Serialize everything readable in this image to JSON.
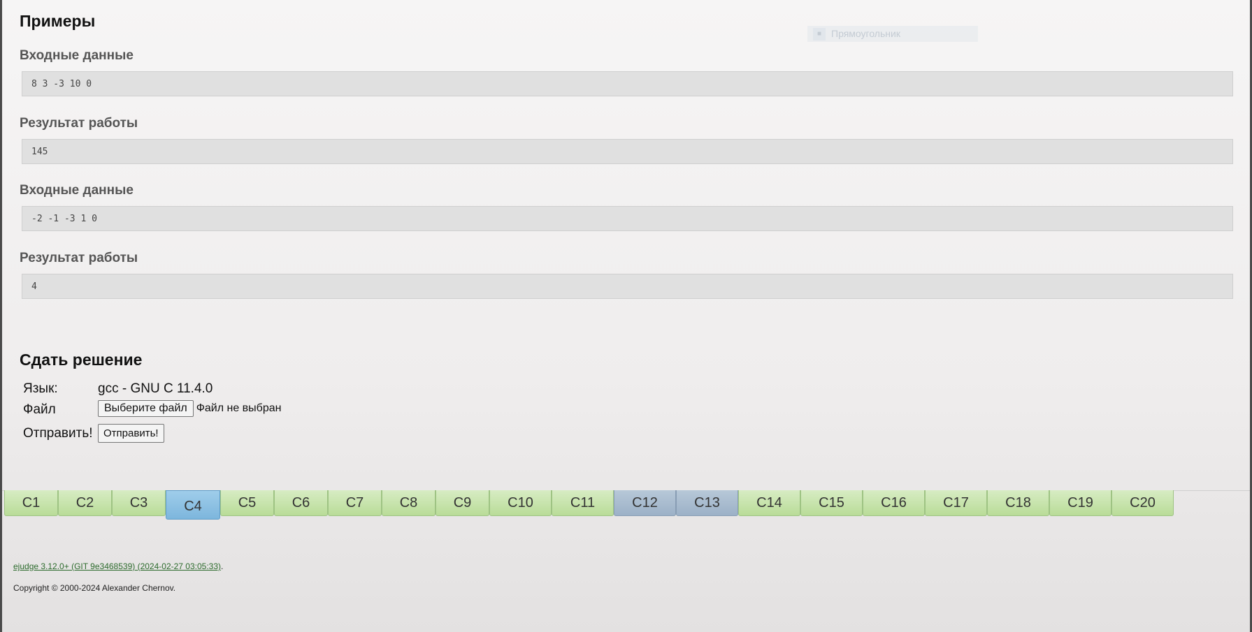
{
  "overlay": {
    "ghost_label": "Прямоугольник"
  },
  "examples": {
    "title": "Примеры",
    "items": [
      {
        "heading": "Входные данные",
        "value": "8 3 -3 10 0"
      },
      {
        "heading": "Результат работы",
        "value": "145"
      },
      {
        "heading": "Входные данные",
        "value": "-2 -1 -3 1 0"
      },
      {
        "heading": "Результат работы",
        "value": "4"
      }
    ]
  },
  "submit": {
    "title": "Сдать решение",
    "language_label": "Язык:",
    "language_value": "gcc - GNU C 11.4.0",
    "file_label": "Файл",
    "file_button": "Выберите файл",
    "file_status": "Файл не выбран",
    "send_label": "Отправить!",
    "send_button": "Отправить!"
  },
  "tabs": {
    "current": "C4",
    "items": [
      "C1",
      "C2",
      "C3",
      "C4",
      "C5",
      "C6",
      "C7",
      "C8",
      "C9",
      "C10",
      "C11",
      "C12",
      "C13",
      "C14",
      "C15",
      "C16",
      "C17",
      "C18",
      "C19",
      "C20"
    ],
    "states": [
      "ok",
      "ok",
      "ok",
      "current",
      "ok",
      "ok",
      "ok",
      "ok",
      "ok",
      "ok",
      "ok",
      "other",
      "other",
      "ok",
      "ok",
      "ok",
      "ok",
      "ok",
      "ok",
      "ok"
    ]
  },
  "footer": {
    "version_link": "ejudge 3.12.0+ (GIT 9e3468539) (2024-02-27 03:05:33)",
    "version_suffix": ".",
    "copyright": "Copyright © 2000-2024 Alexander Chernov."
  },
  "colors": {
    "tab_ok": "#c6e4ab",
    "tab_current": "#8cc2e4",
    "tab_other": "#a9bdd0",
    "link": "#2d6b2d"
  }
}
